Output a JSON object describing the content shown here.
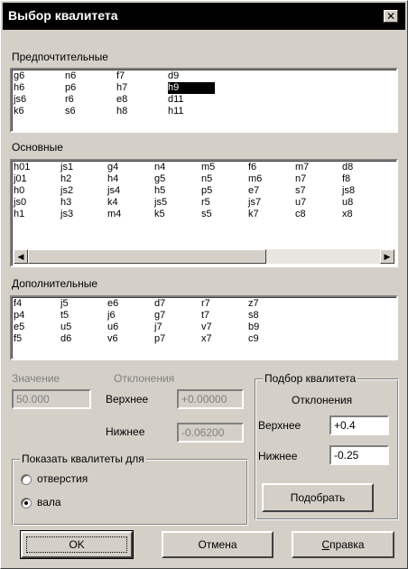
{
  "window": {
    "title": "Выбор квалитета",
    "close_glyph": "✕"
  },
  "preferred": {
    "label": "Предпочтительные",
    "columns": [
      [
        "g6",
        "h6",
        "js6",
        "k6"
      ],
      [
        "n6",
        "p6",
        "r6",
        "s6"
      ],
      [
        "f7",
        "h7",
        "e8",
        "h8"
      ],
      [
        "d9",
        "h9",
        "d11",
        "h11"
      ]
    ],
    "selected": "h9"
  },
  "basic": {
    "label": "Основные",
    "columns": [
      [
        "h01",
        "j01",
        "h0",
        "js0",
        "h1"
      ],
      [
        "js1",
        "h2",
        "js2",
        "h3",
        "js3"
      ],
      [
        "g4",
        "h4",
        "js4",
        "k4",
        "m4"
      ],
      [
        "n4",
        "g5",
        "h5",
        "js5",
        "k5"
      ],
      [
        "m5",
        "n5",
        "p5",
        "r5",
        "s5"
      ],
      [
        "f6",
        "m6",
        "e7",
        "js7",
        "k7"
      ],
      [
        "m7",
        "n7",
        "s7",
        "u7",
        "c8"
      ],
      [
        "d8",
        "f8",
        "js8",
        "u8",
        "x8"
      ]
    ]
  },
  "additional": {
    "label": "Дополнительные",
    "columns": [
      [
        "f4",
        "p4",
        "e5",
        "f5"
      ],
      [
        "j5",
        "t5",
        "u5",
        "d6"
      ],
      [
        "e6",
        "j6",
        "u6",
        "v6"
      ],
      [
        "d7",
        "g7",
        "j7",
        "p7"
      ],
      [
        "r7",
        "t7",
        "v7",
        "x7"
      ],
      [
        "z7",
        "s8",
        "b9",
        "c9"
      ]
    ]
  },
  "value": {
    "label": "Значение",
    "value": "50.000"
  },
  "deviations": {
    "label": "Отклонения",
    "upper_label": "Верхнее",
    "upper_value": "+0.00000",
    "lower_label": "Нижнее",
    "lower_value": "-0.06200"
  },
  "show_group": {
    "legend": "Показать квалитеты для",
    "options": [
      {
        "label": "отверстия",
        "checked": false
      },
      {
        "label": "вала",
        "checked": true
      }
    ]
  },
  "fit_group": {
    "legend": "Подбор квалитета",
    "deviations_label": "Отклонения",
    "upper_label": "Верхнее",
    "upper_value": "+0.4",
    "lower_label": "Нижнее",
    "lower_value": "-0.25",
    "button_pre": "По",
    "button_accel": "д",
    "button_post": "обрать"
  },
  "buttons": {
    "ok": "OK",
    "cancel": "Отмена",
    "help_accel": "С",
    "help_post": "правка"
  }
}
